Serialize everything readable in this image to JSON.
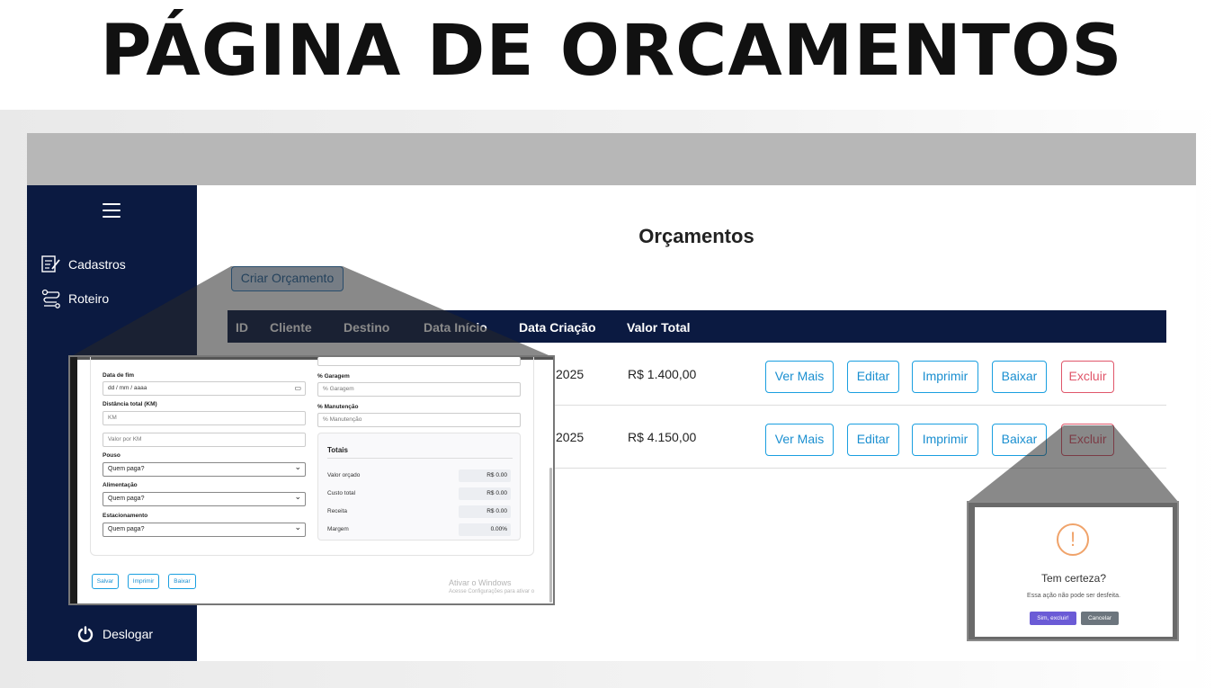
{
  "headline": "PÁGINA DE ORCAMENTOS",
  "sidebar": {
    "items": [
      {
        "label": "Cadastros",
        "icon": "form-icon"
      },
      {
        "label": "Roteiro",
        "icon": "route-icon"
      }
    ],
    "logout_label": "Deslogar"
  },
  "main": {
    "title": "Orçamentos",
    "create_button": "Criar Orçamento",
    "table": {
      "headers": [
        "ID",
        "Cliente",
        "Destino",
        "Data Início",
        "Data Criação",
        "Valor Total"
      ],
      "rows": [
        {
          "data_criacao": "2025",
          "valor_total": "R$ 1.400,00"
        },
        {
          "data_criacao": "2025",
          "valor_total": "R$ 4.150,00"
        }
      ],
      "actions": [
        "Ver Mais",
        "Editar",
        "Imprimir",
        "Baixar",
        "Excluir"
      ]
    }
  },
  "form_zoom": {
    "labels": {
      "data_fim": "Data de fim",
      "distancia": "Distância total (KM)",
      "pouso": "Pouso",
      "alimentacao": "Alimentação",
      "estacionamento": "Estacionamento",
      "garagem": "% Garagem",
      "manutencao": "% Manutenção"
    },
    "placeholders": {
      "data_fim": "dd / mm / aaaa",
      "km": "KM",
      "valor_km": "Valor por KM",
      "garagem": "% Garagem",
      "manutencao": "% Manutenção"
    },
    "selects": {
      "pouso": "Quem paga?",
      "alimentacao": "Quem paga?",
      "estacionamento": "Quem paga?"
    },
    "totals": {
      "title": "Totais",
      "rows": [
        {
          "label": "Valor orçado",
          "value": "R$ 0.00"
        },
        {
          "label": "Custo total",
          "value": "R$ 0.00"
        },
        {
          "label": "Receita",
          "value": "R$ 0.00"
        },
        {
          "label": "Margem",
          "value": "0.00%"
        }
      ]
    },
    "buttons": [
      "Salvar",
      "Imprimir",
      "Baixar"
    ],
    "watermark_title": "Ativar o Windows",
    "watermark_text": "Acesse Configurações para ativar o"
  },
  "modal_zoom": {
    "title": "Tem certeza?",
    "text": "Essa ação não pode ser desfeita.",
    "confirm": "Sim, excluir!",
    "cancel": "Cancelar"
  },
  "colors": {
    "sidebar": "#0b1a41",
    "accent": "#1a9fe0",
    "danger": "#e0566a",
    "confirm": "#6b5bd6"
  }
}
